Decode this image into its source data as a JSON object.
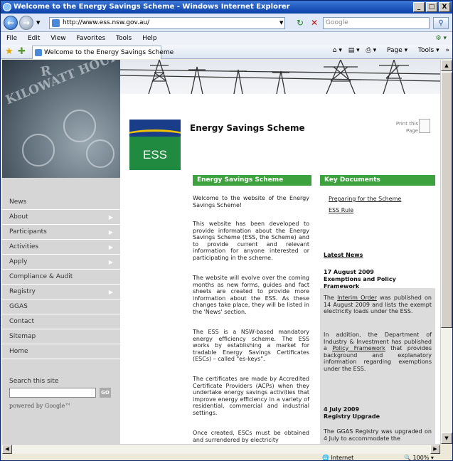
{
  "window": {
    "title": "Welcome to the Energy Savings Scheme - Windows Internet Explorer",
    "controls": [
      "_",
      "□",
      "X"
    ]
  },
  "address_bar": {
    "url": "http://www.ess.nsw.gov.au/",
    "search_placeholder": "Google"
  },
  "menu": {
    "items": [
      "File",
      "Edit",
      "View",
      "Favorites",
      "Tools",
      "Help"
    ]
  },
  "tab": {
    "label": "Welcome to the Energy Savings Scheme"
  },
  "command_bar": {
    "page": "Page",
    "tools": "Tools"
  },
  "hero": {
    "words": [
      "R",
      "KILOWATT HOURS"
    ]
  },
  "logo": {
    "text": "ESS"
  },
  "site": {
    "title": "Energy Savings Scheme",
    "print": "Print this Page"
  },
  "nav": {
    "items": [
      "News",
      "About",
      "Participants",
      "Activities",
      "Apply",
      "Compliance & Audit",
      "Registry",
      "GGAS",
      "Contact",
      "Sitemap",
      "Home"
    ],
    "search_label": "Search this site",
    "go": "GO",
    "powered_by": "powered by Google™"
  },
  "main": {
    "heading": "Energy Savings Scheme",
    "paragraphs": [
      "Welcome to the website of the Energy Savings Scheme!",
      "This website has been developed to provide information about the Energy Savings Scheme (ESS, the Scheme) and to provide current and relevant information for anyone interested or participating in the scheme.",
      "The website will evolve over the coming months as new forms, guides and fact sheets are created to provide more information about the ESS. As these changes take place, they will be listed in the 'News' section.",
      "The ESS is a NSW-based mandatory energy efficiency scheme. The ESS works by establishing a market for tradable Energy Savings Certificates (ESCs) – called \"es-keys\".",
      "The certificates are made by Accredited Certificate Providers (ACPs) when they undertake energy savings activities that improve energy efficiency in a variety of residential, commercial and industrial settings.",
      "Once created, ESCs must be obtained and surrendered by electricity"
    ]
  },
  "key_documents": {
    "heading": "Key Documents",
    "links": [
      "Preparing for the Scheme",
      "ESS Rule"
    ]
  },
  "latest_news": {
    "heading": "Latest News",
    "item1_date": "17 August 2009",
    "item1_title": "Exemptions and Policy Framework",
    "item1_pre": "The ",
    "item1_link": "Interim Order",
    "item1_post": " was published on 14 August 2009 and lists the exempt electricity loads under the ESS.",
    "item1_p2_pre": "In addition, the Department of Industry & Investment has published a ",
    "item1_p2_link": "Policy Framework",
    "item1_p2_post": " that provides background and explanatory information regarding exemptions under the ESS.",
    "item2_date": "4 July 2009",
    "item2_title": "Registry Upgrade",
    "item2_text": "The GGAS Registry was upgraded on 4 July to accommodate the"
  },
  "status": {
    "zone": "Internet",
    "zoom": "100%"
  },
  "colors": {
    "accent_green": "#3da13d",
    "logo_blue": "#1a3d8a",
    "logo_green": "#1f8a40",
    "logo_yellow": "#f2c200"
  }
}
